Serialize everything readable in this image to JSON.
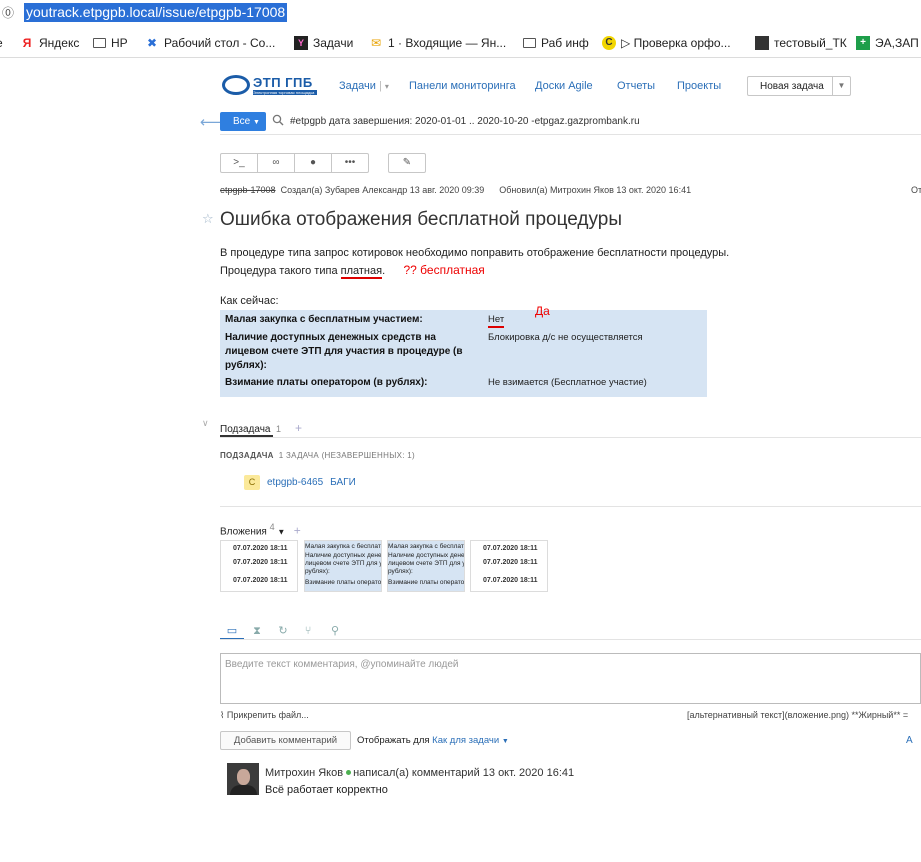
{
  "browser": {
    "url": "youtrack.etpgpb.local/issue/etpgpb-17008",
    "bookmarks": [
      {
        "label": "Яндекс",
        "icon": "yandex-icon"
      },
      {
        "label": "HP",
        "icon": "folder-icon"
      },
      {
        "label": "Рабочий стол - Co...",
        "icon": "confluence-icon"
      },
      {
        "label": "Задачи",
        "icon": "youtrack-icon"
      },
      {
        "label": "1 · Входящие — Ян...",
        "icon": "mail-icon"
      },
      {
        "label": "Раб инф",
        "icon": "folder-icon"
      },
      {
        "label": "▷ Проверка орфо...",
        "icon": "speller-icon"
      },
      {
        "label": "тестовый_ТК",
        "icon": "tk-icon"
      },
      {
        "label": "ЭА,ЗАП",
        "icon": "sheets-icon"
      }
    ]
  },
  "header": {
    "logo_text": "ЭТП ГПБ",
    "logo_subtext": "Электронная торговая площадка",
    "nav": [
      "Задачи",
      "Панели мониторинга",
      "Доски Agile",
      "Отчеты",
      "Проекты"
    ],
    "new_task": "Новая задача"
  },
  "search": {
    "scope": "Все",
    "query": "#etpgpb дата завершения: 2020-01-01 .. 2020-10-20 -etpgaz.gazprombank.ru"
  },
  "issue": {
    "id": "etpgpb-17008",
    "created": "Создал(а) Зубарев Александр 13 авг. 2020 09:39",
    "updated": "Обновил(а) Митрохин Яков 13 окт. 2020 16:41",
    "edge_text": "От",
    "title": "Ошибка отображения бесплатной процедуры",
    "desc_line1": "В процедуре типа запрос котировок необходимо поправить  отображение бесплатности процедуры.",
    "desc_line2_prefix": "Процедура такого типа ",
    "desc_paid": "платная",
    "desc_line2_suffix": ".",
    "annotation_free": "?? бесплатная",
    "now_label": "Как сейчас:",
    "table": [
      {
        "key": "Малая закупка с бесплатным участием:",
        "value": "Нет"
      },
      {
        "key": "Наличие доступных денежных средств на лицевом счете ЭТП для участия в процедуре (в рублях):",
        "value": "Блокировка д/с не осуществляется"
      },
      {
        "key": "Взимание платы оператором (в рублях):",
        "value": "Не взимается (Бесплатное участие)"
      }
    ],
    "annotation_yes": "Да"
  },
  "subtasks": {
    "tab_label": "Подзадача",
    "tab_count": "1",
    "heading": "ПОДЗАДАЧА",
    "heading_detail": "1 ЗАДАЧА (НЕЗАВЕРШЕННЫХ: 1)",
    "items": [
      {
        "badge": "C",
        "id": "etpgpb-6465",
        "summary": "БАГИ"
      }
    ]
  },
  "attachments": {
    "title": "Вложения",
    "count": "4",
    "thumbs": [
      {
        "kind": "dates",
        "lines": [
          "07.07.2020 18:11",
          "07.07.2020 18:11",
          "07.07.2020 18:11"
        ]
      },
      {
        "kind": "text",
        "lines": [
          "Малая закупка с бесплат",
          "Наличие доступных денеж",
          "лицевом счете ЭТП для у",
          "рублях):",
          "Взимание платы операто"
        ]
      },
      {
        "kind": "text",
        "lines": [
          "Малая закупка с бесплат",
          "Наличие доступных денеж",
          "лицевом счете ЭТП для у",
          "рублях):",
          "Взимание платы операто"
        ]
      },
      {
        "kind": "dates",
        "lines": [
          "07.07.2020 18:11",
          "07.07.2020 18:11",
          "07.07.2020 18:11"
        ]
      }
    ]
  },
  "comments_area": {
    "placeholder": "Введите текст комментария, @упоминайте людей",
    "attach_file": "Прикрепить файл...",
    "markdown_hint": "[альтернативный текст](вложение.png) **Жирный** =",
    "add_button": "Добавить комментарий",
    "display_for_label": "Отображать для",
    "display_for_value": "Как для задачи",
    "right_edge": "A"
  },
  "comment": {
    "author": "Митрохин Яков",
    "meta": "написал(а) комментарий 13 окт. 2020 16:41",
    "text": "Всё работает корректно"
  },
  "colors": {
    "accent": "#2f7fe0",
    "link": "#2b6fb8",
    "table_bg": "#d6e4f3",
    "annotation": "#e00000"
  }
}
